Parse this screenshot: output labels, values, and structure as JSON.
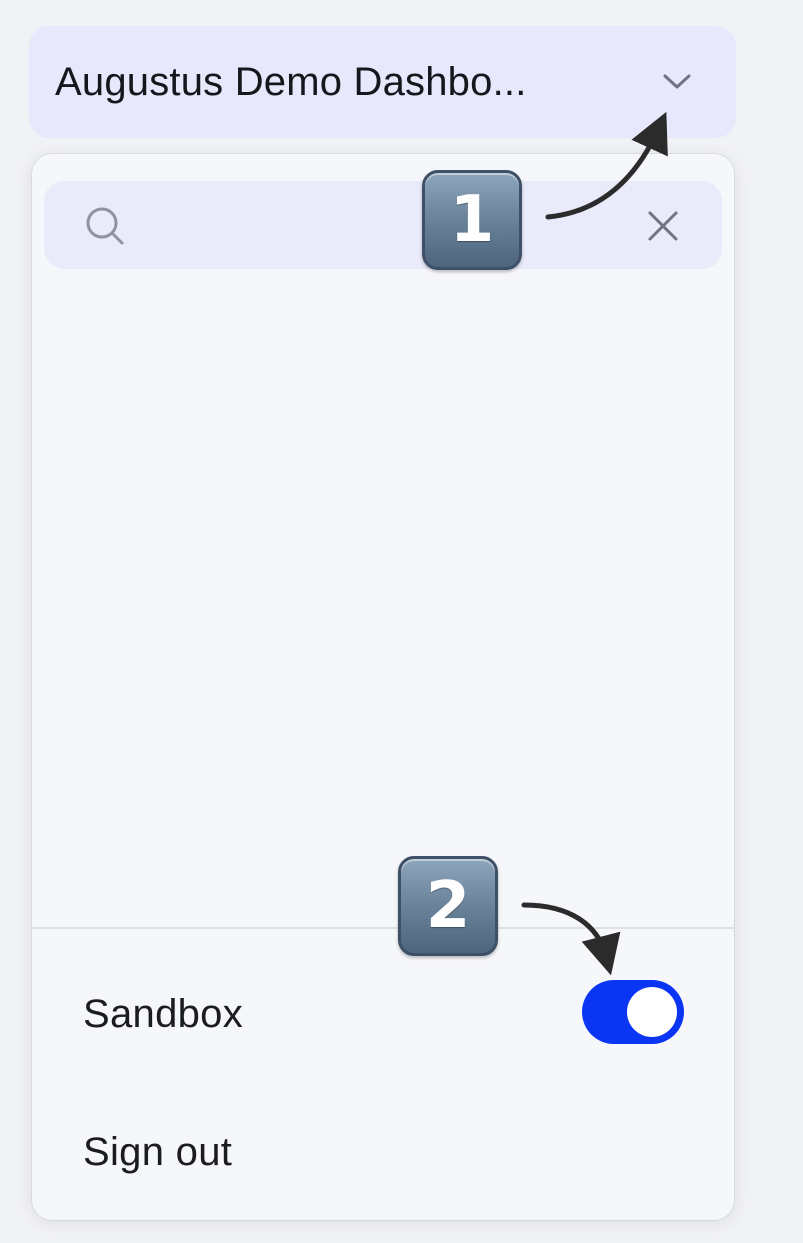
{
  "workspace_switcher": {
    "title": "Augustus Demo Dashbo...",
    "chevron_icon": "chevron-down-icon"
  },
  "search": {
    "value": "",
    "placeholder": "",
    "search_icon": "search-icon",
    "clear_icon": "close-icon"
  },
  "menu": {
    "sandbox_label": "Sandbox",
    "sandbox_enabled": true,
    "sign_out_label": "Sign out"
  },
  "annotations": {
    "badge_1": "1",
    "badge_2": "2"
  },
  "colors": {
    "accent": "#0a35f3",
    "switcher_bg": "#e7e8fb",
    "panel_bg": "#f6f7fa"
  }
}
